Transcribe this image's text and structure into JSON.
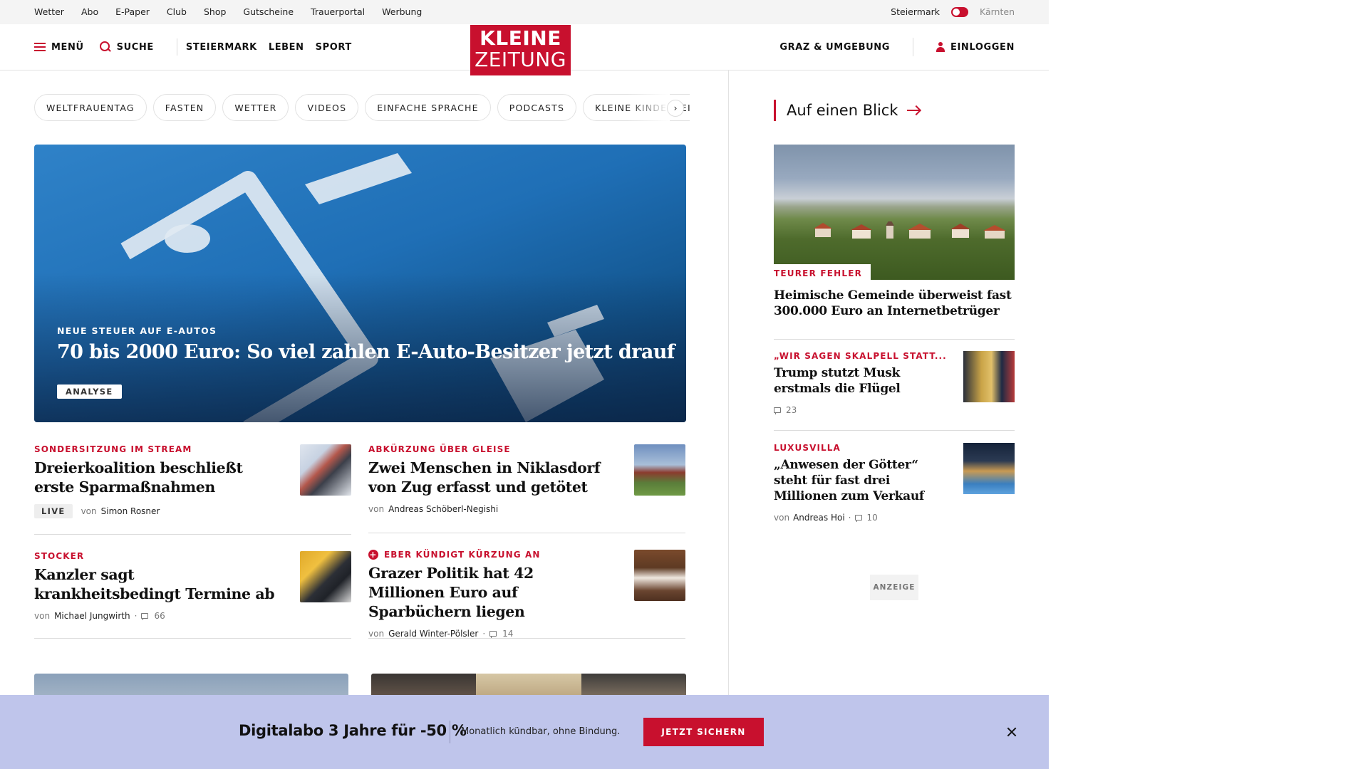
{
  "utility_bar": {
    "links": [
      "Wetter",
      "Abo",
      "E-Paper",
      "Club",
      "Shop",
      "Gutscheine",
      "Trauerportal",
      "Werbung"
    ],
    "region_active": "Steiermark",
    "region_inactive": "Kärnten"
  },
  "header": {
    "menu_label": "MENÜ",
    "search_label": "SUCHE",
    "sections": [
      "STEIERMARK",
      "LEBEN",
      "SPORT"
    ],
    "logo_line1": "KLEINE",
    "logo_line2": "ZEITUNG",
    "local_label": "GRAZ & UMGEBUNG",
    "login_label": "EINLOGGEN"
  },
  "topics": [
    "WELTFRAUENTAG",
    "FASTEN",
    "WETTER",
    "VIDEOS",
    "EINFACHE SPRACHE",
    "PODCASTS",
    "KLEINE KINDERZEITUNG"
  ],
  "hero": {
    "kicker": "NEUE STEUER AUF E-AUTOS",
    "title": "70 bis 2000 Euro: So viel zahlen E-Auto-Besitzer jetzt drauf",
    "badge": "ANALYSE"
  },
  "articles": [
    {
      "kicker": "SONDERSITZUNG IM STREAM",
      "headline": "Dreierkoalition beschließt erste Sparmaßnahmen",
      "live": "LIVE",
      "by": "von",
      "author": "Simon Rosner",
      "comments": ""
    },
    {
      "kicker": "ABKÜRZUNG ÜBER GLEISE",
      "headline": "Zwei Menschen in Niklasdorf von Zug erfasst und getötet",
      "by": "von",
      "author": "Andreas Schöberl-Negishi",
      "comments": ""
    },
    {
      "kicker": "STOCKER",
      "headline": "Kanzler sagt krankheitsbedingt Termine ab",
      "by": "von",
      "author": "Michael Jungwirth",
      "comments": "66"
    },
    {
      "kicker": "EBER KÜNDIGT KÜRZUNG AN",
      "headline": "Grazer Politik hat 42 Millionen Euro auf Sparbüchern liegen",
      "by": "von",
      "author": "Gerald Winter-Pölsler",
      "comments": "14"
    }
  ],
  "sidebar": {
    "title": "Auf einen Blick",
    "lead": {
      "kicker": "TEURER FEHLER",
      "headline": "Heimische Gemeinde überweist fast 300.000 Euro an Internetbetrüger"
    },
    "items": [
      {
        "kicker": "„WIR SAGEN SKALPELL STATT...",
        "headline": "Trump stutzt Musk erstmals die Flügel",
        "comments": "23"
      },
      {
        "kicker": "LUXUSVILLA",
        "headline": "„Anwesen der Götter“ steht für fast drei Millionen zum Verkauf",
        "by": "von",
        "author": "Andreas Hoi",
        "comments": "10"
      }
    ],
    "ad_label": "ANZEIGE"
  },
  "promo": {
    "title": "Digitalabo 3 Jahre für -50 %",
    "subtitle": "Monatlich kündbar, ohne Bindung.",
    "cta": "JETZT SICHERN"
  },
  "colors": {
    "brand_red": "#c8102e",
    "promo_bg": "#bfc5eb",
    "utility_bg": "#f4f4f4"
  },
  "icons": [
    "hamburger-icon",
    "search-icon",
    "user-icon",
    "chevron-right-icon",
    "arrow-right-icon",
    "comment-icon",
    "plus-icon",
    "close-icon"
  ]
}
